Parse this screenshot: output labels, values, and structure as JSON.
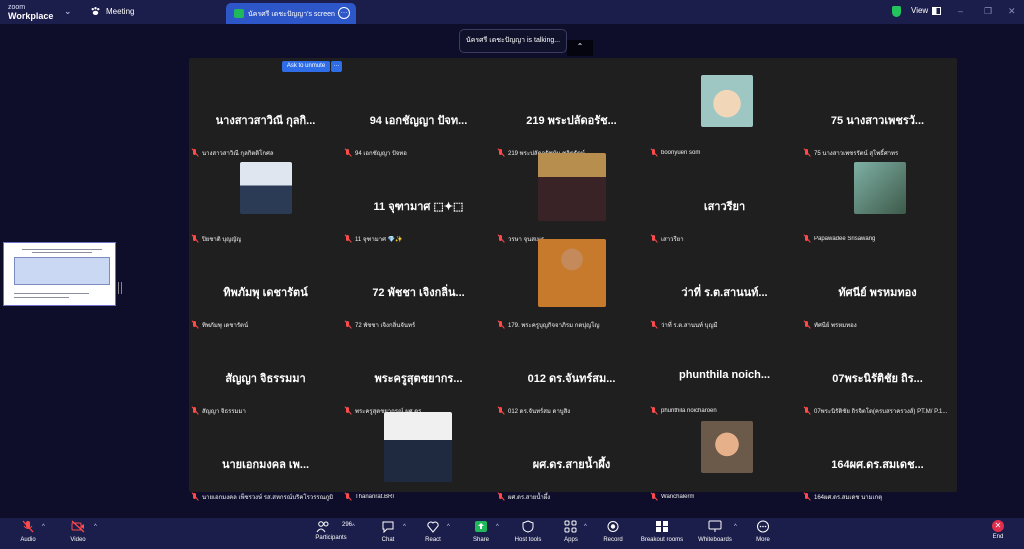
{
  "app": {
    "logo_line1": "zoom",
    "logo_line2": "Workplace",
    "meeting_label": "Meeting"
  },
  "share_tab": {
    "label": "นัครศรี เดชะปัญญา's screen"
  },
  "topright": {
    "view_label": "View"
  },
  "talking_banner": "นัครศรี เดชะปัญญา  is talking...",
  "ask_unmute": "Ask to unmute",
  "tiles": [
    {
      "big": "นางสาวสาวิณี กุลกิ...",
      "name": "นางสาวสาวิณี กุลกิตติโกศล"
    },
    {
      "big": "94 เอกชัญญา ปัจท...",
      "name": "94 เอกชัญญา ปัจทอ"
    },
    {
      "big": "219 พระปลัดอรัช...",
      "name": "219 พระปลัดอรัชษัน ชลิตรัตน์"
    },
    {
      "big": "",
      "name": "boonyuen som"
    },
    {
      "big": "75 นางสาวเพชรวั...",
      "name": "75 นางสาวเพชรรัตน์ สุโพธิ์ศาทร"
    },
    {
      "big": "",
      "name": "ปิยชาติ  บุญญัญ"
    },
    {
      "big": "11 จุฑามาศ ⬚✦⬚",
      "name": "11 จุฑามาศ 💎✨"
    },
    {
      "big": "",
      "name": "วรษา จุนสเมธ"
    },
    {
      "big": "เสาวรียา",
      "name": "เสาวรียา"
    },
    {
      "big": "",
      "name": "Papawadee Srisawang"
    },
    {
      "big": "ทิพภัมพุ เดชารัตน์",
      "name": "ทิพภัมพุ เดชารัตน์"
    },
    {
      "big": "72 พัชชา เจิงกลิ่น...",
      "name": "72 พัชชา เจิงกลิ่นจันทร์"
    },
    {
      "big": "",
      "name": "179. พระครูบุญกิจจาภิรม กตปุญโญ"
    },
    {
      "big": "ว่าที่ ร.ต.สานนท์...",
      "name": "ว่าที่ ร.ต.สานนท์  บุญมี"
    },
    {
      "big": "ทัศนีย์ พรหมทอง",
      "name": "ทัศนีย์ พรหมทอง"
    },
    {
      "big": "สัญญา จิธรรมมา",
      "name": "สัญญา จิธรรมมา"
    },
    {
      "big": "พระครูสุตชยากร...",
      "name": "พระครูสุตชยากรณ์,ผศ.ดร."
    },
    {
      "big": "012 ดร.จันทร์สม...",
      "name": "012 ดร.จันทร์สม ดาบูสิง"
    },
    {
      "big": "phunthila   noich...",
      "name": "phunthila  noicharoen"
    },
    {
      "big": "07พระนิรัติชัย ถิร...",
      "name": "07พระนิรัติชัย ถิรจิตโต(ครบสราครวงส์) PT.M/ P.1..."
    },
    {
      "big": "นายเอกมงคล  เพ...",
      "name": "นายเอกมงคล  เพ็ชรวงษ์  รส.สหกรณ์บริคโรวรรณภูมิ"
    },
    {
      "big": "",
      "name": "Thananrat.BRI"
    },
    {
      "big": "ผศ.ดร.สายน้ำผึ้ง",
      "name": "ผศ.ดร.สายน้ำผึ้ง"
    },
    {
      "big": "",
      "name": "Wanchalerm"
    },
    {
      "big": "164ผศ.ดร.สมเดช...",
      "name": "164ผศ.ดร.สมเดช นามเกตุ"
    }
  ],
  "toolbar": {
    "audio": "Audio",
    "video": "Video",
    "participants": "Participants",
    "participants_count": "296",
    "chat": "Chat",
    "react": "React",
    "share": "Share",
    "host_tools": "Host tools",
    "apps": "Apps",
    "record": "Record",
    "breakout": "Breakout rooms",
    "whiteboards": "Whiteboards",
    "more": "More",
    "end": "End"
  },
  "colors": {
    "accent": "#2d56c9",
    "topbar": "#1b1d4a",
    "share_green": "#1fb85a",
    "muted_red": "#ff4b4b",
    "end_red": "#e02e4c"
  }
}
